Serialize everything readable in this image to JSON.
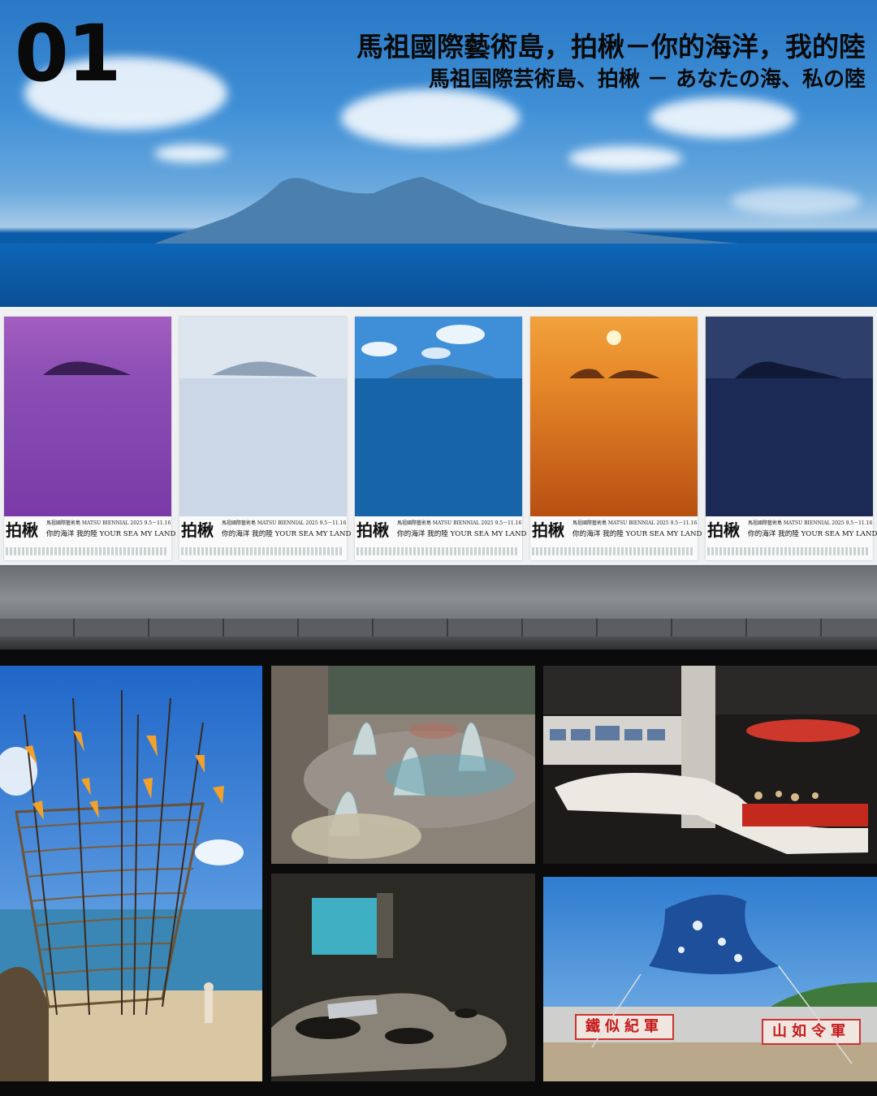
{
  "header": {
    "number": "01",
    "title_zh": "馬祖國際藝術島，拍楸－你的海洋，我的陸",
    "title_ja": "馬祖国際芸術島、拍楸 － あなたの海、私の陸"
  },
  "poster": {
    "brand": "拍楸",
    "meta": "馬祖國際藝術島 MATSU BIENNIAL 2025 9.5－11.16",
    "tagline": "你的海洋 我的陸  YOUR SEA MY LAND"
  },
  "colors": {
    "poster_purple": "#8a4fb0",
    "poster_mist": "#dfe6ee",
    "poster_blue": "#1a6fb0",
    "poster_orange": "#e0731e",
    "poster_navy": "#1c2f5c"
  },
  "gallery": {
    "banner_left": "鐵似紀軍",
    "banner_right": "山如令軍"
  }
}
